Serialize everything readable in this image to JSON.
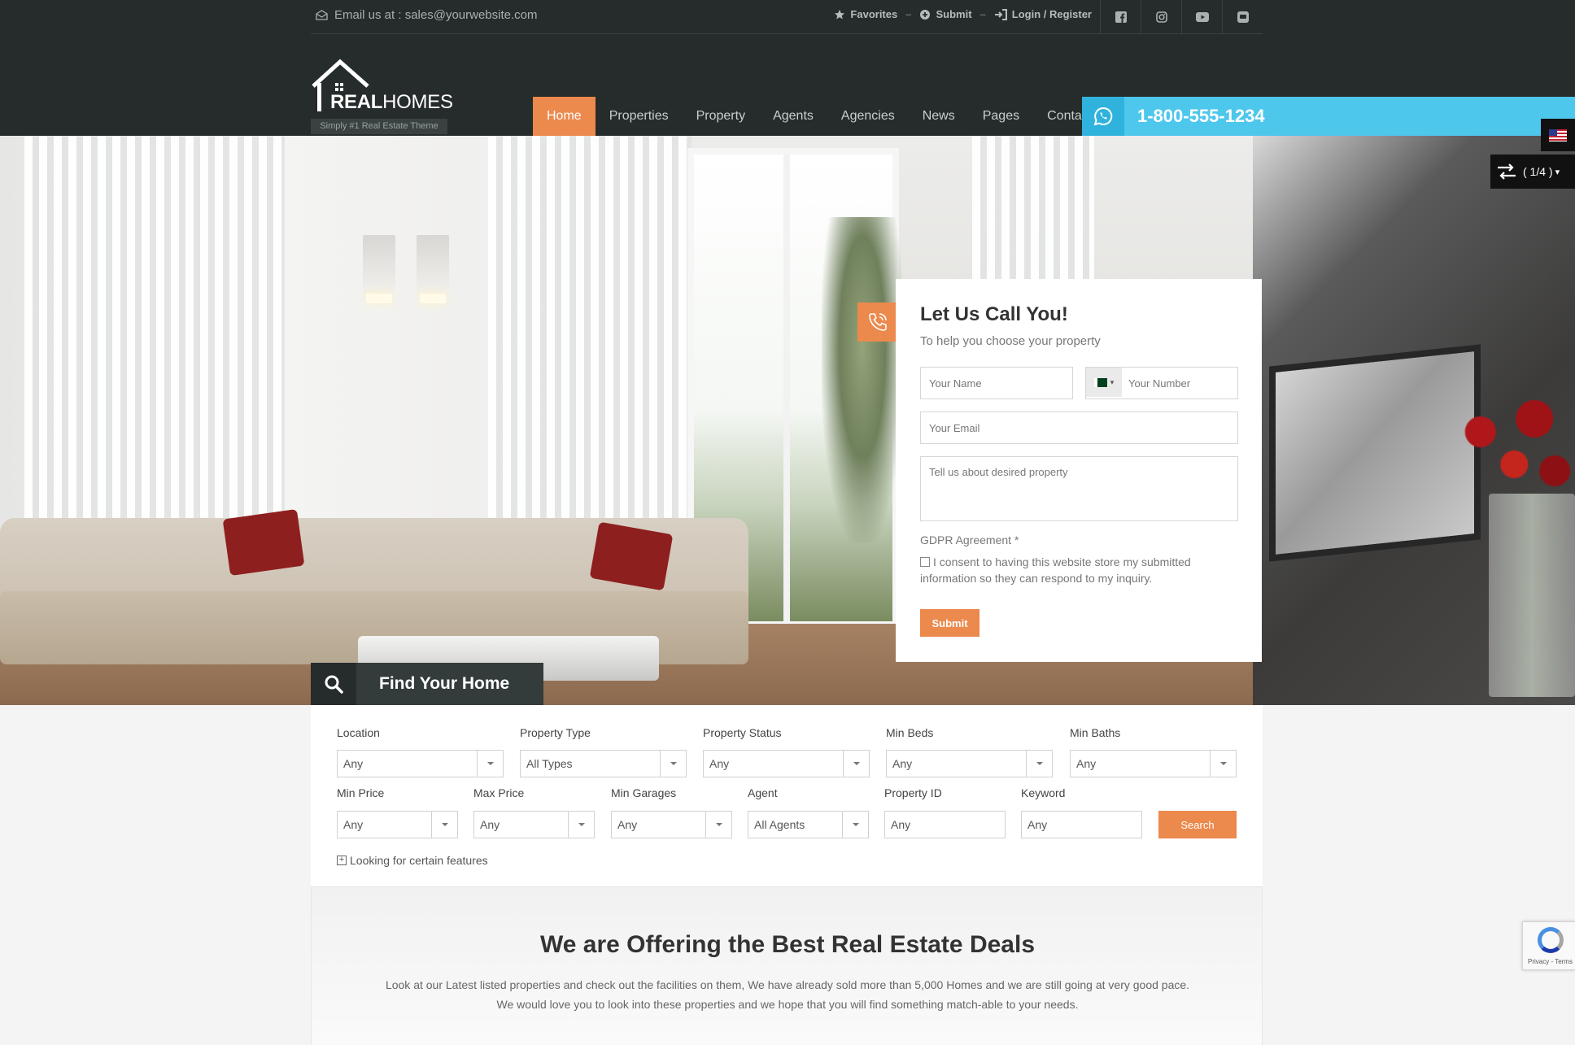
{
  "topbar": {
    "email": "Email us at : sales@yourwebsite.com",
    "favorites": "Favorites",
    "submit": "Submit",
    "login": "Login / Register",
    "socials": [
      "facebook-icon",
      "instagram-icon",
      "youtube-icon",
      "chat-icon"
    ]
  },
  "logo": {
    "bold": "REAL",
    "light": "HOMES",
    "tagline": "Simply #1 Real Estate Theme"
  },
  "nav": {
    "items": [
      "Home",
      "Properties",
      "Property",
      "Agents",
      "Agencies",
      "News",
      "Pages",
      "Contact"
    ],
    "active": "Home"
  },
  "phone": {
    "number": "1-800-555-1234"
  },
  "switcher": {
    "label": "( 1/4 )"
  },
  "callback": {
    "title": "Let Us Call You!",
    "subtitle": "To help you choose your property",
    "name_placeholder": "Your Name",
    "number_placeholder": "Your Number",
    "email_placeholder": "Your Email",
    "message_placeholder": "Tell us about desired property",
    "gdpr_title": "GDPR Agreement *",
    "gdpr_text": "I consent to having this website store my submitted information so they can respond to my inquiry.",
    "submit": "Submit"
  },
  "search": {
    "tab_label": "Find Your Home",
    "row1": [
      {
        "label": "Location",
        "value": "Any"
      },
      {
        "label": "Property Type",
        "value": "All Types"
      },
      {
        "label": "Property Status",
        "value": "Any"
      },
      {
        "label": "Min Beds",
        "value": "Any"
      },
      {
        "label": "Min Baths",
        "value": "Any"
      }
    ],
    "row2": [
      {
        "label": "Min Price",
        "value": "Any"
      },
      {
        "label": "Max Price",
        "value": "Any"
      },
      {
        "label": "Min Garages",
        "value": "Any"
      },
      {
        "label": "Agent",
        "value": "All Agents"
      },
      {
        "label": "Property ID",
        "value": "Any"
      },
      {
        "label": "Keyword",
        "value": "Any"
      }
    ],
    "button": "Search",
    "features_link": "Looking for certain features"
  },
  "offer": {
    "title": "We are Offering the Best Real Estate Deals",
    "text": "Look at our Latest listed properties and check out the facilities on them, We have already sold more than 5,000 Homes and we are still going at very good pace. We would love you to look into these properties and we hope that you will find something match-able to your needs."
  },
  "recaptcha": {
    "text": "Privacy - Terms"
  },
  "colors": {
    "accent": "#ec894d",
    "header_bg": "#262b2b",
    "phone_bar": "#4dc7ec"
  }
}
